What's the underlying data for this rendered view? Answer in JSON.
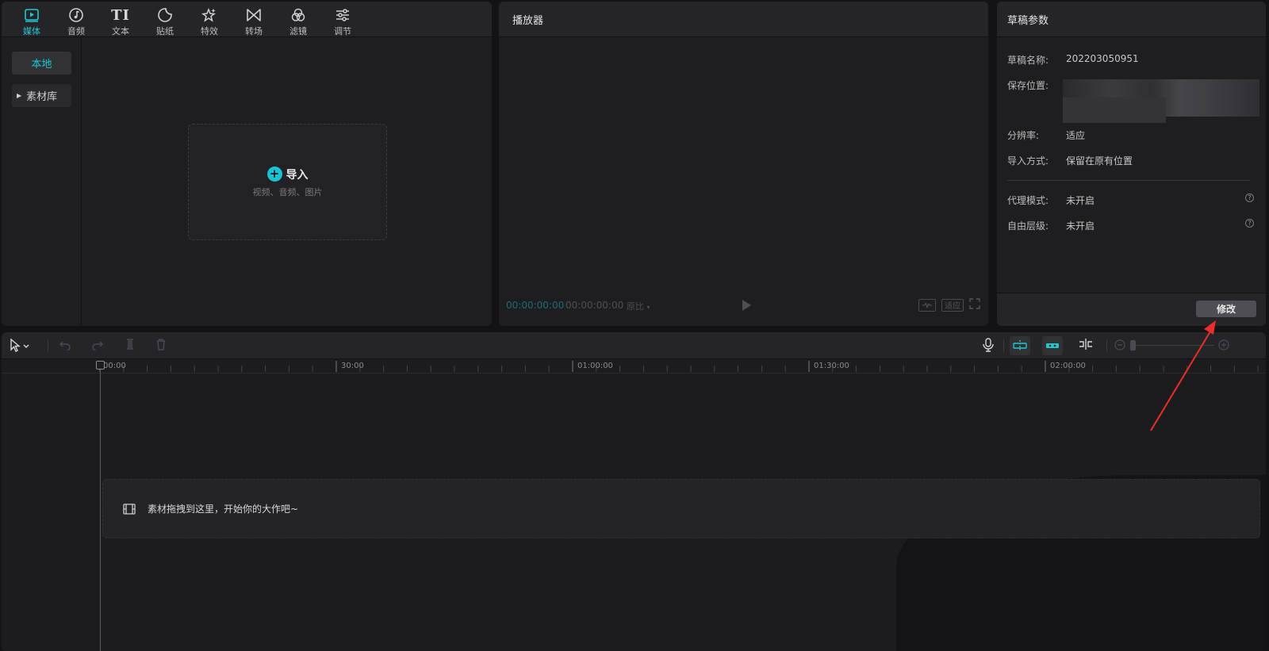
{
  "media": {
    "tabs": [
      {
        "label": "媒体",
        "icon": "media-play-icon"
      },
      {
        "label": "音频",
        "icon": "music-note-icon"
      },
      {
        "label": "文本",
        "icon": "text-TI-icon"
      },
      {
        "label": "贴纸",
        "icon": "sticker-icon"
      },
      {
        "label": "特效",
        "icon": "effects-star-icon"
      },
      {
        "label": "转场",
        "icon": "transition-bowtie-icon"
      },
      {
        "label": "滤镜",
        "icon": "filter-circles-icon"
      },
      {
        "label": "调节",
        "icon": "adjust-sliders-icon"
      }
    ],
    "tab_icon_text": "TI",
    "side": {
      "local": "本地",
      "library": "素材库"
    },
    "import": {
      "title": "导入",
      "subtitle": "视频、音频、图片",
      "plus": "+"
    }
  },
  "player": {
    "title": "播放器",
    "current_time": "00:00:00:00",
    "total_time": "00:00:00:00",
    "ratio": "原比",
    "fit_label": "适应"
  },
  "draft": {
    "title": "草稿参数",
    "rows": [
      {
        "key": "草稿名称:",
        "value": "202203050951"
      },
      {
        "key": "保存位置:",
        "value": ""
      },
      {
        "key": "分辨率:",
        "value": "适应"
      },
      {
        "key": "导入方式:",
        "value": "保留在原有位置"
      },
      {
        "key": "代理模式:",
        "value": "未开启"
      },
      {
        "key": "自由层级:",
        "value": "未开启"
      }
    ],
    "help": "?",
    "modify_label": "修改"
  },
  "timeline": {
    "ticks": [
      "00:00",
      "30:00",
      "01:00:00",
      "01:30:00",
      "02:00:00"
    ],
    "drop_hint": "素材拖拽到这里，开始你的大作吧~"
  },
  "colors": {
    "accent": "#22c7d2",
    "annotation_arrow": "#e8302a"
  }
}
